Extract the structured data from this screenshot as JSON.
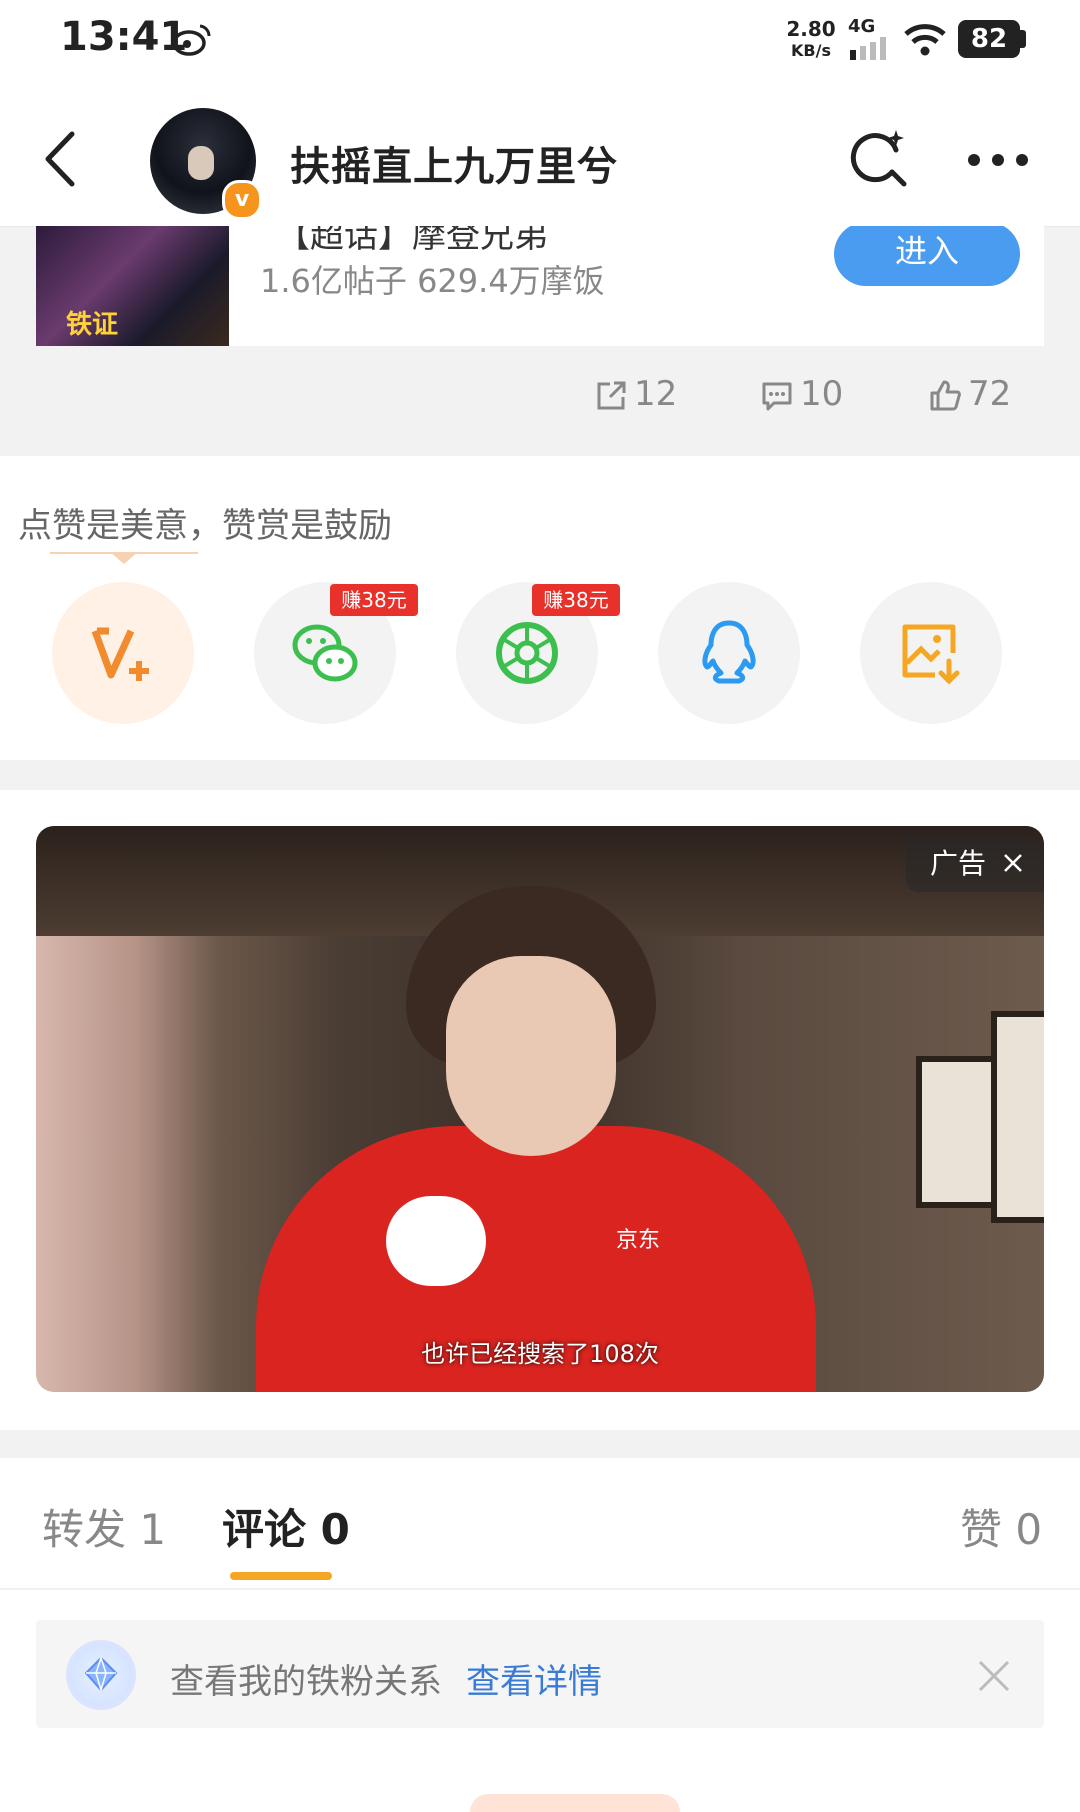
{
  "status_bar": {
    "time": "13:41",
    "net_speed": "2.80",
    "net_speed_unit": "KB/s",
    "network": "4G",
    "battery": "82"
  },
  "header": {
    "title": "扶摇直上九万里兮",
    "back_icon": "back-arrow-icon",
    "search_icon": "search-sparkle-icon",
    "more_icon": "more-dots-icon"
  },
  "topic_card": {
    "title": "【超话】摩登兄弟",
    "meta": "1.6亿帖子 629.4万摩饭",
    "enter_label": "进入"
  },
  "post_actions": {
    "repost_count": "12",
    "comment_count": "10",
    "like_count": "72"
  },
  "reward": {
    "text": "点赞是美意，赞赏是鼓励",
    "wechat_badge": "赚38元",
    "moments_badge": "赚38元"
  },
  "ad": {
    "label": "广告",
    "subtitle": "也许已经搜索了108次",
    "brand_text": "京东"
  },
  "tabs": [
    {
      "label": "转发 1"
    },
    {
      "label": "评论 0"
    },
    {
      "label": "赞 0"
    }
  ],
  "fan_banner": {
    "text": "查看我的铁粉关系",
    "link": "查看详情"
  },
  "colors": {
    "accent_orange": "#f5a623",
    "link_blue": "#3a7bd5",
    "enter_blue": "#4a9cf0",
    "badge_red": "#e8312b"
  }
}
